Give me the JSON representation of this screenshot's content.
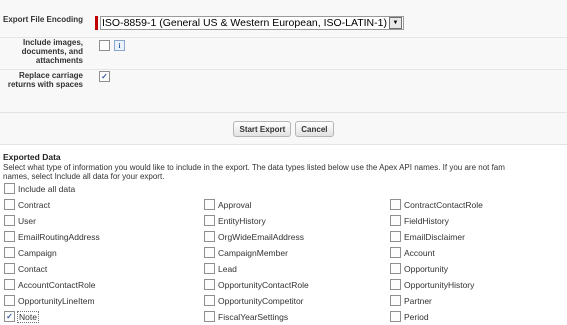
{
  "form": {
    "encoding": {
      "label": "Export File Encoding",
      "selected": "ISO-8859-1 (General US & Western European, ISO-LATIN-1)"
    },
    "include_images": {
      "label": "Include images, documents, and attachments",
      "checked": false
    },
    "replace_cr": {
      "label": "Replace carriage returns with spaces",
      "checked": true
    },
    "start_export_label": "Start Export",
    "cancel_label": "Cancel"
  },
  "exported_data": {
    "title": "Exported Data",
    "description_line1": "Select what type of information you would like to include in the export. The data types listed below use the Apex API names. If you are not fam",
    "description_line2": "names, select Include all data for your export.",
    "include_all_label": "Include all data",
    "items": [
      {
        "label": "Contract",
        "checked": false
      },
      {
        "label": "Approval",
        "checked": false
      },
      {
        "label": "ContractContactRole",
        "checked": false
      },
      {
        "label": "User",
        "checked": false
      },
      {
        "label": "EntityHistory",
        "checked": false
      },
      {
        "label": "FieldHistory",
        "checked": false
      },
      {
        "label": "EmailRoutingAddress",
        "checked": false
      },
      {
        "label": "OrgWideEmailAddress",
        "checked": false
      },
      {
        "label": "EmailDisclaimer",
        "checked": false
      },
      {
        "label": "Campaign",
        "checked": false
      },
      {
        "label": "CampaignMember",
        "checked": false
      },
      {
        "label": "Account",
        "checked": false
      },
      {
        "label": "Contact",
        "checked": false
      },
      {
        "label": "Lead",
        "checked": false
      },
      {
        "label": "Opportunity",
        "checked": false
      },
      {
        "label": "AccountContactRole",
        "checked": false
      },
      {
        "label": "OpportunityContactRole",
        "checked": false
      },
      {
        "label": "OpportunityHistory",
        "checked": false
      },
      {
        "label": "OpportunityLineItem",
        "checked": false
      },
      {
        "label": "OpportunityCompetitor",
        "checked": false
      },
      {
        "label": "Partner",
        "checked": false
      },
      {
        "label": "Note",
        "checked": true
      },
      {
        "label": "FiscalYearSettings",
        "checked": false
      },
      {
        "label": "Period",
        "checked": false
      }
    ]
  }
}
